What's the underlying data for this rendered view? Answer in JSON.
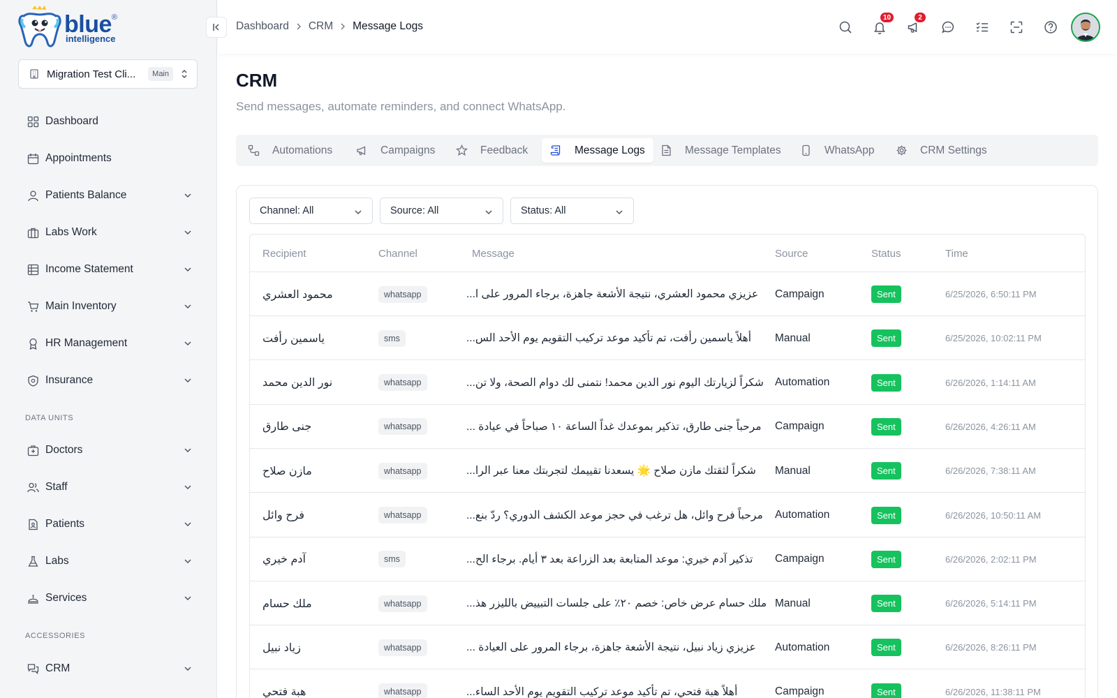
{
  "logo": {
    "brand": "blue",
    "registered": "®",
    "sub": "intelligence"
  },
  "branch": {
    "name": "Migration Test Cli...",
    "badge": "Main"
  },
  "sidebar": {
    "items": [
      {
        "label": "Dashboard",
        "icon": "grid-icon"
      },
      {
        "label": "Appointments",
        "icon": "calendar-icon"
      },
      {
        "label": "Patients Balance",
        "icon": "user-icon"
      },
      {
        "label": "Labs Work",
        "icon": "briefcase-icon"
      },
      {
        "label": "Income Statement",
        "icon": "table-icon"
      },
      {
        "label": "Main Inventory",
        "icon": "cart-icon"
      },
      {
        "label": "HR Management",
        "icon": "award-icon"
      },
      {
        "label": "Insurance",
        "icon": "shield-icon"
      }
    ],
    "section_data_units": "DATA UNITS",
    "data_units": [
      {
        "label": "Doctors",
        "icon": "hospital-icon"
      },
      {
        "label": "Staff",
        "icon": "users-icon"
      },
      {
        "label": "Patients",
        "icon": "file-user-icon"
      },
      {
        "label": "Labs",
        "icon": "flask-icon"
      },
      {
        "label": "Services",
        "icon": "service-icon"
      }
    ],
    "section_accessories": "ACCESSORIES",
    "accessories": [
      {
        "label": "CRM",
        "icon": "messages-icon"
      }
    ]
  },
  "breadcrumb": [
    "Dashboard",
    "CRM",
    "Message Logs"
  ],
  "header": {
    "notifications_count": "10",
    "announcements_count": "2"
  },
  "page": {
    "title": "CRM",
    "subtitle": "Send messages, automate reminders, and connect WhatsApp."
  },
  "tabs": [
    {
      "label": "Automations",
      "icon": "workflow-icon"
    },
    {
      "label": "Campaigns",
      "icon": "megaphone-icon"
    },
    {
      "label": "Feedback",
      "icon": "star-icon"
    },
    {
      "label": "Message Logs",
      "icon": "scroll-icon"
    },
    {
      "label": "Message Templates",
      "icon": "document-icon"
    },
    {
      "label": "WhatsApp",
      "icon": "phone-icon"
    },
    {
      "label": "CRM Settings",
      "icon": "gear-icon"
    }
  ],
  "active_tab": "Message Logs",
  "filters": {
    "channel": "Channel: All",
    "source": "Source: All",
    "status": "Status: All"
  },
  "table": {
    "columns": [
      "Recipient",
      "Channel",
      "Message",
      "Source",
      "Status",
      "Time"
    ],
    "rows": [
      {
        "recipient": "محمود العشري",
        "channel": "whatsapp",
        "message": "عزيزي محمود العشري، نتيجة الأشعة جاهزة، برجاء المرور على ا...",
        "source": "Campaign",
        "status": "Sent",
        "time": "6/25/2026, 6:50:11 PM"
      },
      {
        "recipient": "ياسمين رأفت",
        "channel": "sms",
        "message": "أهلاً ياسمين رأفت، تم تأكيد موعد تركيب التقويم يوم الأحد الس...",
        "source": "Manual",
        "status": "Sent",
        "time": "6/25/2026, 10:02:11 PM"
      },
      {
        "recipient": "نور الدين محمد",
        "channel": "whatsapp",
        "message": "شكراً لزيارتك اليوم نور الدين محمد! نتمنى لك دوام الصحة، ولا تن...",
        "source": "Automation",
        "status": "Sent",
        "time": "6/26/2026, 1:14:11 AM"
      },
      {
        "recipient": "جنى طارق",
        "channel": "whatsapp",
        "message": "مرحباً جنى طارق، تذكير بموعدك غداً الساعة ١٠ صباحاً في عيادة ...",
        "source": "Campaign",
        "status": "Sent",
        "time": "6/26/2026, 4:26:11 AM"
      },
      {
        "recipient": "مازن صلاح",
        "channel": "whatsapp",
        "message": "شكراً لثقتك مازن صلاح 🌟 يسعدنا تقييمك لتجربتك معنا عبر الرا...",
        "source": "Manual",
        "status": "Sent",
        "time": "6/26/2026, 7:38:11 AM"
      },
      {
        "recipient": "فرح وائل",
        "channel": "whatsapp",
        "message": "مرحباً فرح وائل، هل ترغب في حجز موعد الكشف الدوري؟ ردّ بنع...",
        "source": "Automation",
        "status": "Sent",
        "time": "6/26/2026, 10:50:11 AM"
      },
      {
        "recipient": "آدم خيري",
        "channel": "sms",
        "message": "تذكير آدم خيري: موعد المتابعة بعد الزراعة بعد ٣ أيام. برجاء الح...",
        "source": "Campaign",
        "status": "Sent",
        "time": "6/26/2026, 2:02:11 PM"
      },
      {
        "recipient": "ملك حسام",
        "channel": "whatsapp",
        "message": "ملك حسام عرض خاص: خصم ٢٠٪ على جلسات التبييض بالليزر هذ...",
        "source": "Manual",
        "status": "Sent",
        "time": "6/26/2026, 5:14:11 PM"
      },
      {
        "recipient": "زياد نبيل",
        "channel": "whatsapp",
        "message": "عزيزي زياد نبيل، نتيجة الأشعة جاهزة، برجاء المرور على العيادة ...",
        "source": "Automation",
        "status": "Sent",
        "time": "6/26/2026, 8:26:11 PM"
      },
      {
        "recipient": "هبة فتحي",
        "channel": "whatsapp",
        "message": "أهلاً هبة فتحي، تم تأكيد موعد تركيب التقويم يوم الأحد الساء...",
        "source": "Campaign",
        "status": "Sent",
        "time": "6/26/2026, 11:38:11 PM"
      }
    ]
  },
  "colors": {
    "brand": "#1a4fa0",
    "status_sent": "#16c25e",
    "badge": "#e11d2e",
    "avatar_ring": "#16a34a"
  }
}
